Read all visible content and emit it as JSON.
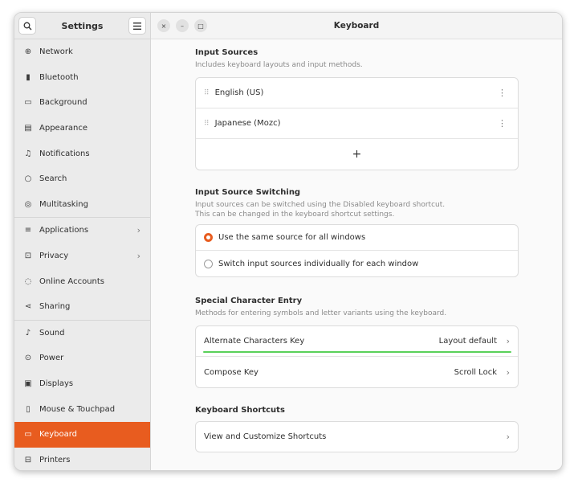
{
  "sidebar": {
    "title": "Settings",
    "search_icon": "search-icon",
    "menu_icon": "hamburger-icon",
    "items": [
      {
        "label": "Network",
        "icon": "network-icon",
        "glyph": "⊕"
      },
      {
        "label": "Bluetooth",
        "icon": "bluetooth-icon",
        "glyph": "▮"
      },
      {
        "label": "Background",
        "icon": "background-icon",
        "glyph": "▭"
      },
      {
        "label": "Appearance",
        "icon": "appearance-icon",
        "glyph": "▤"
      },
      {
        "label": "Notifications",
        "icon": "bell-icon",
        "glyph": "♫"
      },
      {
        "label": "Search",
        "icon": "search-icon",
        "glyph": "○"
      },
      {
        "label": "Multitasking",
        "icon": "multitasking-icon",
        "glyph": "◎"
      },
      {
        "label": "Applications",
        "icon": "applications-icon",
        "glyph": "≡",
        "has_chevron": true
      },
      {
        "label": "Privacy",
        "icon": "lock-icon",
        "glyph": "⊡",
        "has_chevron": true
      },
      {
        "label": "Online Accounts",
        "icon": "cloud-icon",
        "glyph": "◌"
      },
      {
        "label": "Sharing",
        "icon": "share-icon",
        "glyph": "⋖"
      },
      {
        "label": "Sound",
        "icon": "music-note-icon",
        "glyph": "♪"
      },
      {
        "label": "Power",
        "icon": "power-icon",
        "glyph": "⊙"
      },
      {
        "label": "Displays",
        "icon": "display-icon",
        "glyph": "▣"
      },
      {
        "label": "Mouse & Touchpad",
        "icon": "mouse-icon",
        "glyph": "▯"
      },
      {
        "label": "Keyboard",
        "icon": "keyboard-icon",
        "glyph": "▭",
        "active": true
      },
      {
        "label": "Printers",
        "icon": "printer-icon",
        "glyph": "⊟"
      }
    ]
  },
  "header": {
    "title": "Keyboard",
    "close_glyph": "×",
    "minimize_glyph": "–",
    "maximize_glyph": "□"
  },
  "input_sources": {
    "title": "Input Sources",
    "subtitle": "Includes keyboard layouts and input methods.",
    "items": [
      "English (US)",
      "Japanese (Mozc)"
    ],
    "add_label": "+"
  },
  "switching": {
    "title": "Input Source Switching",
    "subtitle_line1": "Input sources can be switched using the Disabled keyboard shortcut.",
    "subtitle_line2": "This can be changed in the keyboard shortcut settings.",
    "options": [
      {
        "label": "Use the same source for all windows",
        "selected": true
      },
      {
        "label": "Switch input sources individually for each window",
        "selected": false
      }
    ]
  },
  "special": {
    "title": "Special Character Entry",
    "subtitle": "Methods for entering symbols and letter variants using the keyboard.",
    "alternate_label": "Alternate Characters Key",
    "alternate_value": "Layout default",
    "compose_label": "Compose Key",
    "compose_value": "Scroll Lock",
    "highlight_color": "#5ad15a"
  },
  "shortcuts": {
    "title": "Keyboard Shortcuts",
    "view_label": "View and Customize Shortcuts"
  },
  "colors": {
    "accent": "#e85c1f"
  }
}
